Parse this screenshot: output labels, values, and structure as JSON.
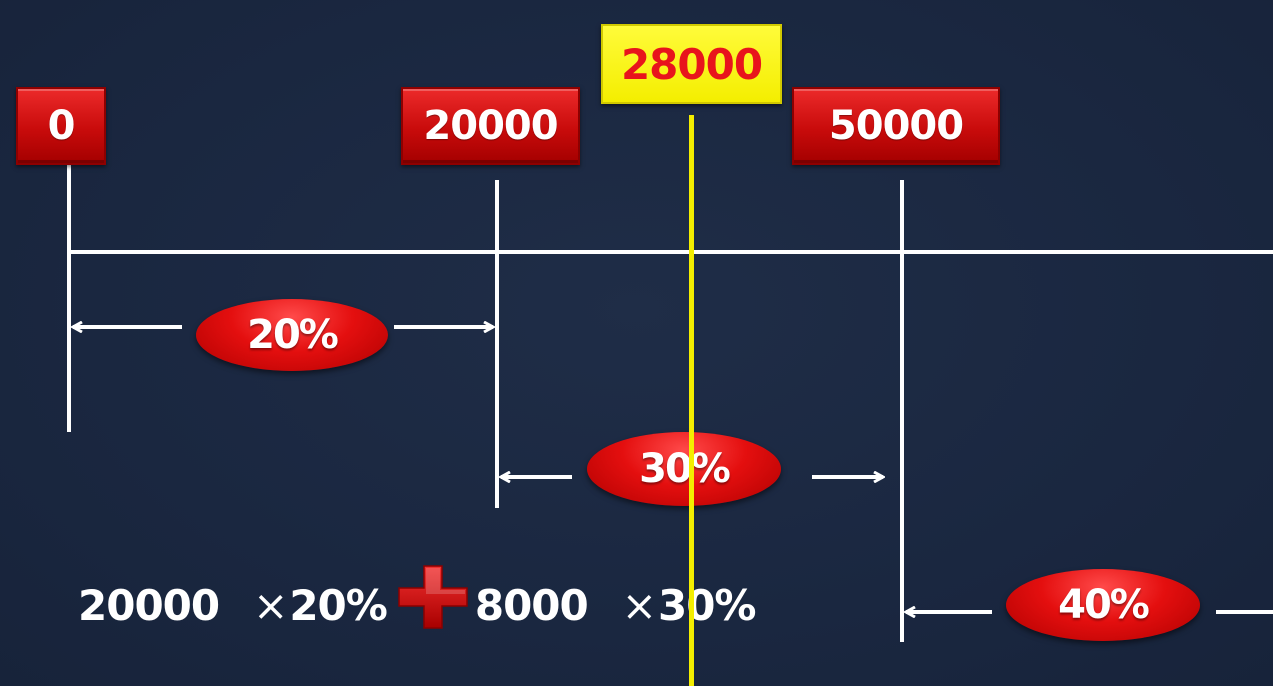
{
  "markers": {
    "zero": "0",
    "twenty_thousand": "20000",
    "fifty_thousand": "50000",
    "income": "28000"
  },
  "rates": {
    "bracket1": "20%",
    "bracket2": "30%",
    "bracket3": "40%"
  },
  "formula": {
    "amount1": "20000",
    "times1": "×",
    "rate1": "20%",
    "amount2": "8000",
    "times2": "×",
    "rate2": "30%"
  },
  "colors": {
    "background": "#1a2740",
    "marker_red": "#c80b0b",
    "highlight_yellow": "#f4ee00",
    "highlight_text": "#e8141c",
    "line": "#ffffff"
  }
}
